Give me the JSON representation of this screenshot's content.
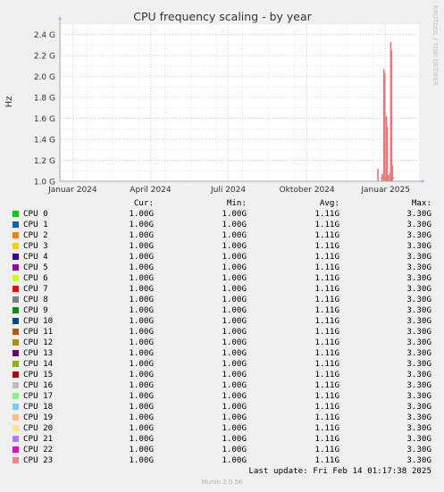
{
  "chart_data": {
    "type": "line",
    "title": "CPU frequency scaling - by year",
    "ylabel": "Hz",
    "xlabel": "",
    "ylim": [
      1.0,
      2.5
    ],
    "yticks": [
      "1.0 G",
      "1.2 G",
      "1.4 G",
      "1.6 G",
      "1.8 G",
      "2.0 G",
      "2.2 G",
      "2.4 G"
    ],
    "ytick_values": [
      1.0,
      1.2,
      1.4,
      1.6,
      1.8,
      2.0,
      2.2,
      2.4
    ],
    "xticks": [
      "Januar 2024",
      "April 2024",
      "Juli 2024",
      "Oktober 2024",
      "Januar 2025"
    ],
    "xtick_values": [
      0,
      91,
      182,
      274,
      366
    ],
    "xlim": [
      -15,
      405
    ],
    "grid": true,
    "series_color": "#e7777b",
    "spikes": [
      {
        "x": 357,
        "y": 1.12
      },
      {
        "x": 362,
        "y": 1.07
      },
      {
        "x": 364,
        "y": 2.07
      },
      {
        "x": 365,
        "y": 2.03
      },
      {
        "x": 367,
        "y": 1.62
      },
      {
        "x": 368,
        "y": 1.52
      },
      {
        "x": 369,
        "y": 1.06
      },
      {
        "x": 371,
        "y": 1.08
      },
      {
        "x": 372,
        "y": 2.33
      },
      {
        "x": 373,
        "y": 2.25
      },
      {
        "x": 374,
        "y": 1.15
      }
    ]
  },
  "watermark": "RRDTOOL / TOBI OETIKER",
  "legend_headers": {
    "cur": "Cur:",
    "min": "Min:",
    "avg": "Avg:",
    "max": "Max:"
  },
  "legend": [
    {
      "name": "CPU 0",
      "color": "#00cc00",
      "cur": "1.00G",
      "min": "1.00G",
      "avg": "1.11G",
      "max": "3.30G"
    },
    {
      "name": "CPU 1",
      "color": "#0066b3",
      "cur": "1.00G",
      "min": "1.00G",
      "avg": "1.11G",
      "max": "3.30G"
    },
    {
      "name": "CPU 2",
      "color": "#ff8000",
      "cur": "1.00G",
      "min": "1.00G",
      "avg": "1.11G",
      "max": "3.30G"
    },
    {
      "name": "CPU 3",
      "color": "#ffcc00",
      "cur": "1.00G",
      "min": "1.00G",
      "avg": "1.11G",
      "max": "3.30G"
    },
    {
      "name": "CPU 4",
      "color": "#330099",
      "cur": "1.00G",
      "min": "1.00G",
      "avg": "1.11G",
      "max": "3.30G"
    },
    {
      "name": "CPU 5",
      "color": "#990099",
      "cur": "1.00G",
      "min": "1.00G",
      "avg": "1.11G",
      "max": "3.30G"
    },
    {
      "name": "CPU 6",
      "color": "#ccff00",
      "cur": "1.00G",
      "min": "1.00G",
      "avg": "1.11G",
      "max": "3.30G"
    },
    {
      "name": "CPU 7",
      "color": "#ff0000",
      "cur": "1.00G",
      "min": "1.00G",
      "avg": "1.11G",
      "max": "3.30G"
    },
    {
      "name": "CPU 8",
      "color": "#808080",
      "cur": "1.00G",
      "min": "1.00G",
      "avg": "1.11G",
      "max": "3.30G"
    },
    {
      "name": "CPU 9",
      "color": "#008f00",
      "cur": "1.00G",
      "min": "1.00G",
      "avg": "1.11G",
      "max": "3.30G"
    },
    {
      "name": "CPU 10",
      "color": "#00487d",
      "cur": "1.00G",
      "min": "1.00G",
      "avg": "1.11G",
      "max": "3.30G"
    },
    {
      "name": "CPU 11",
      "color": "#b35a00",
      "cur": "1.00G",
      "min": "1.00G",
      "avg": "1.11G",
      "max": "3.30G"
    },
    {
      "name": "CPU 12",
      "color": "#b38f00",
      "cur": "1.00G",
      "min": "1.00G",
      "avg": "1.11G",
      "max": "3.30G"
    },
    {
      "name": "CPU 13",
      "color": "#6b006b",
      "cur": "1.00G",
      "min": "1.00G",
      "avg": "1.11G",
      "max": "3.30G"
    },
    {
      "name": "CPU 14",
      "color": "#8fb300",
      "cur": "1.00G",
      "min": "1.00G",
      "avg": "1.11G",
      "max": "3.30G"
    },
    {
      "name": "CPU 15",
      "color": "#b30000",
      "cur": "1.00G",
      "min": "1.00G",
      "avg": "1.11G",
      "max": "3.30G"
    },
    {
      "name": "CPU 16",
      "color": "#bebebe",
      "cur": "1.00G",
      "min": "1.00G",
      "avg": "1.11G",
      "max": "3.30G"
    },
    {
      "name": "CPU 17",
      "color": "#80ff80",
      "cur": "1.00G",
      "min": "1.00G",
      "avg": "1.11G",
      "max": "3.30G"
    },
    {
      "name": "CPU 18",
      "color": "#80c9ff",
      "cur": "1.00G",
      "min": "1.00G",
      "avg": "1.11G",
      "max": "3.30G"
    },
    {
      "name": "CPU 19",
      "color": "#ffc080",
      "cur": "1.00G",
      "min": "1.00G",
      "avg": "1.11G",
      "max": "3.30G"
    },
    {
      "name": "CPU 20",
      "color": "#ffe680",
      "cur": "1.00G",
      "min": "1.00G",
      "avg": "1.11G",
      "max": "3.30G"
    },
    {
      "name": "CPU 21",
      "color": "#aa80ff",
      "cur": "1.00G",
      "min": "1.00G",
      "avg": "1.11G",
      "max": "3.30G"
    },
    {
      "name": "CPU 22",
      "color": "#ee00cc",
      "cur": "1.00G",
      "min": "1.00G",
      "avg": "1.11G",
      "max": "3.30G"
    },
    {
      "name": "CPU 23",
      "color": "#ff8080",
      "cur": "1.00G",
      "min": "1.00G",
      "avg": "1.11G",
      "max": "3.30G"
    }
  ],
  "last_update": "Last update: Fri Feb 14 01:17:38 2025",
  "munin_version": "Munin 2.0.56"
}
